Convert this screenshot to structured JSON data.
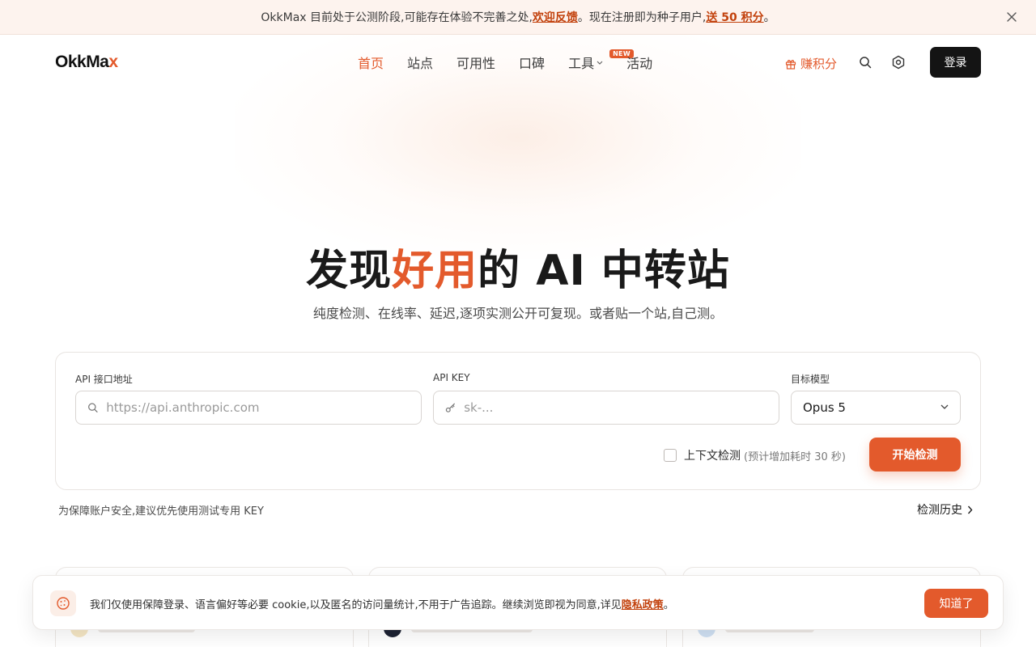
{
  "announcement": {
    "text_before": "OkkMax 目前处于公测阶段,可能存在体验不完善之处,",
    "feedback_link": "欢迎反馈",
    "text_middle": "。现在注册即为种子用户,",
    "points_link": "送 50 积分",
    "text_after": "。"
  },
  "header": {
    "logo_main": "OkkMa",
    "logo_accent": "x",
    "nav": [
      {
        "label": "首页"
      },
      {
        "label": "站点"
      },
      {
        "label": "可用性"
      },
      {
        "label": "口碑"
      },
      {
        "label": "工具",
        "badge": "NEW"
      },
      {
        "label": "活动"
      }
    ],
    "earn_label": "赚积分",
    "login_label": "登录"
  },
  "hero": {
    "title_before": "发现",
    "title_highlight": "好用",
    "title_after": "的 AI 中转站",
    "subtitle": "纯度检测、在线率、延迟,逐项实测公开可复现。或者贴一个站,自己测。"
  },
  "check_form": {
    "api_url_label": "API 接口地址",
    "api_url_placeholder": "https://api.anthropic.com",
    "api_key_label": "API KEY",
    "api_key_placeholder": "sk-...",
    "model_label": "目标模型",
    "model_value": "Opus 5",
    "context_check_label": "上下文检测",
    "context_check_hint": "(预计增加耗时 30 秒)",
    "start_label": "开始检测"
  },
  "safety_note": "为保障账户安全,建议优先使用测试专用 KEY",
  "history_label": "检测历史",
  "cookie": {
    "text": "我们仅使用保障登录、语言偏好等必要 cookie,以及匿名的访问量统计,不用于广告追踪。继续浏览即视为同意,详见",
    "policy_link": "隐私政策",
    "text_end": "。",
    "ok_label": "知道了"
  },
  "colors": {
    "accent": "#e35a2c",
    "dark": "#141414"
  }
}
